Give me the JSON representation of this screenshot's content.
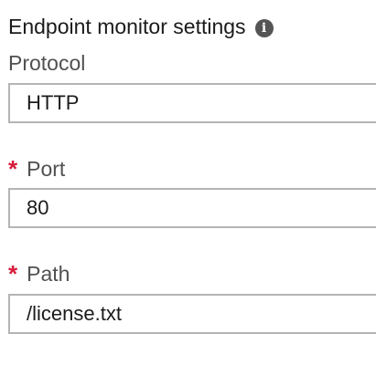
{
  "section": {
    "title": "Endpoint monitor settings",
    "info_icon": "info-icon",
    "info_glyph": "i"
  },
  "fields": {
    "protocol": {
      "label": "Protocol",
      "value": "HTTP",
      "required": false
    },
    "port": {
      "label": "Port",
      "value": "80",
      "required": true
    },
    "path": {
      "label": "Path",
      "value": "/license.txt",
      "required": true
    }
  },
  "required_marker": "*",
  "colors": {
    "required": "#d81b3a",
    "border": "#b4b4b4",
    "label": "#505050",
    "info_icon_bg": "#555555"
  }
}
